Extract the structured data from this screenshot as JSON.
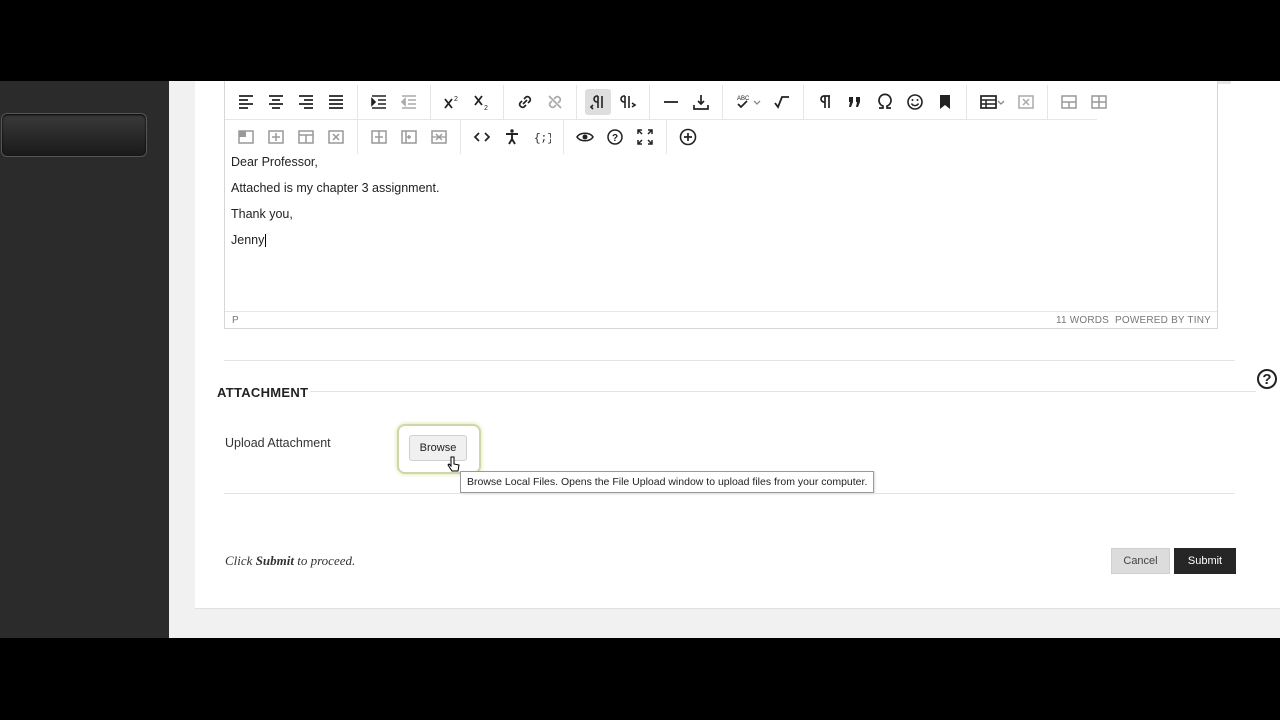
{
  "editor": {
    "lines": [
      "Dear Professor,",
      "Attached is my chapter 3 assignment.",
      "Thank you,",
      "Jenny"
    ],
    "status_path": "P",
    "word_count": "11 WORDS",
    "powered_by": "POWERED BY TINY",
    "toolbar_row1": [
      "align-left-icon",
      "align-center-icon",
      "align-right-icon",
      "justify-icon",
      "indent-icon",
      "outdent-icon",
      "superscript-icon",
      "subscript-icon",
      "link-icon",
      "unlink-icon",
      "ltr-icon",
      "rtl-icon",
      "horizontal-rule-icon",
      "insert-icon",
      "spellcheck-icon",
      "math-icon",
      "paragraph-icon",
      "blockquote-icon",
      "special-char-icon",
      "emoji-icon",
      "bookmark-icon",
      "table-icon",
      "delete-table-icon",
      "row-before-icon",
      "row-after-icon"
    ],
    "toolbar_row2": [
      "cell-props-icon",
      "insert-col-before-icon",
      "insert-col-after-icon",
      "delete-col-icon",
      "split-cell-icon",
      "merge-cell-icon",
      "delete-row-icon",
      "source-code-icon",
      "accessibility-icon",
      "template-icon",
      "preview-icon",
      "help-circle-icon",
      "fullscreen-icon",
      "add-content-icon"
    ]
  },
  "attachment": {
    "section_title": "ATTACHMENT",
    "upload_label": "Upload Attachment",
    "browse_label": "Browse",
    "tooltip": "Browse Local Files.  Opens the File Upload window to upload files from your computer."
  },
  "footer": {
    "instruction_prefix": "Click",
    "instruction_bold": "Submit",
    "instruction_suffix": "to proceed.",
    "cancel_label": "Cancel",
    "submit_label": "Submit"
  },
  "help_symbol": "?",
  "colors": {
    "submit_bg": "#262626",
    "sidebar_bg": "#2b2b2b",
    "browse_glow": "#cfd6a8"
  }
}
